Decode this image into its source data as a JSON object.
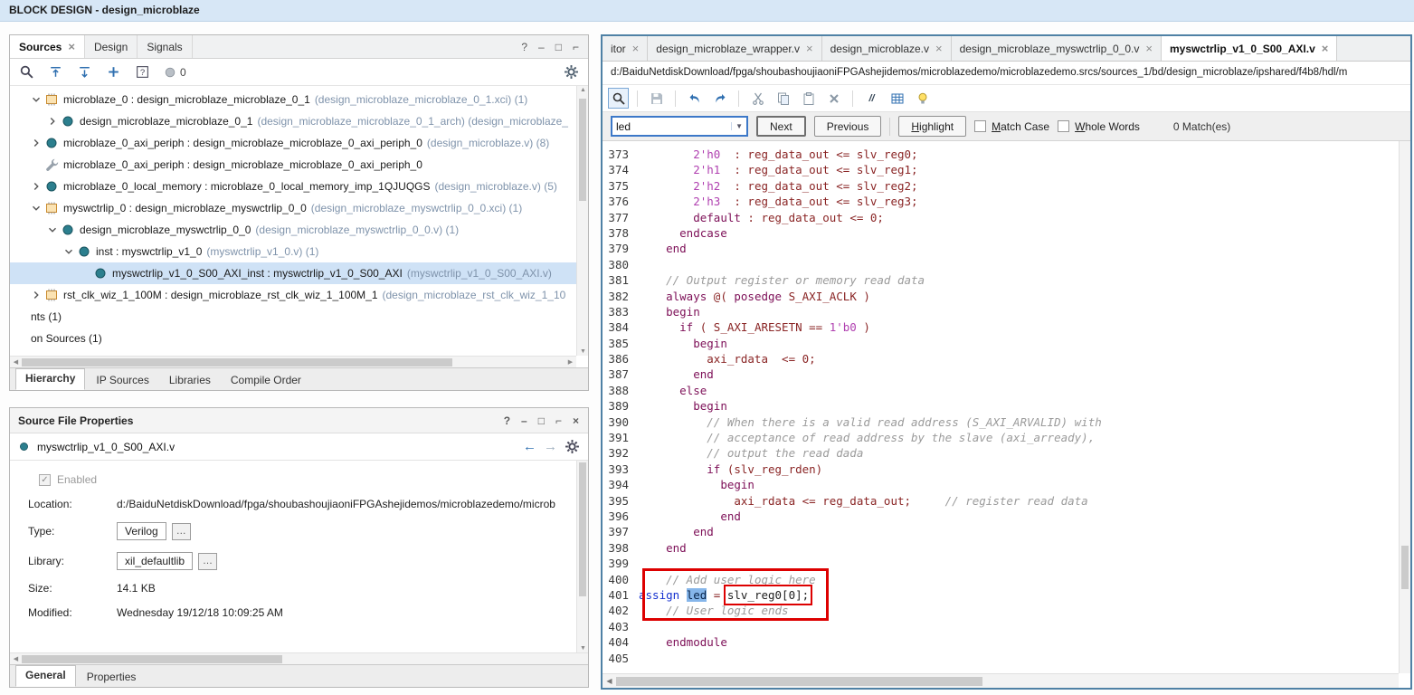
{
  "titlebar": {
    "title": "BLOCK DESIGN - design_microblaze"
  },
  "sources": {
    "tabs": [
      {
        "label": "Sources",
        "active": true,
        "closable": true
      },
      {
        "label": "Design",
        "active": false,
        "closable": false
      },
      {
        "label": "Signals",
        "active": false,
        "closable": false
      }
    ],
    "window_controls": [
      "help",
      "minimize",
      "maximize",
      "float"
    ],
    "toolbar": {
      "icons": [
        "search",
        "collapse-all",
        "expand-all",
        "add",
        "help-box"
      ],
      "messages_count": "0"
    },
    "tree": [
      {
        "indent": 1,
        "arrow": "open",
        "icon": "ip",
        "main": "microblaze_0 : design_microblaze_microblaze_0_1",
        "dim": "(design_microblaze_microblaze_0_1.xci) (1)",
        "selected": false
      },
      {
        "indent": 2,
        "arrow": "closed",
        "icon": "module",
        "main": "design_microblaze_microblaze_0_1",
        "dim": "(design_microblaze_microblaze_0_1_arch) (design_microblaze_",
        "selected": false
      },
      {
        "indent": 1,
        "arrow": "closed",
        "icon": "module",
        "main": "microblaze_0_axi_periph : design_microblaze_microblaze_0_axi_periph_0",
        "dim": "(design_microblaze.v) (8)",
        "selected": false
      },
      {
        "indent": 1,
        "arrow": "none",
        "icon": "wrench",
        "main": "microblaze_0_axi_periph : design_microblaze_microblaze_0_axi_periph_0",
        "dim": "",
        "selected": false
      },
      {
        "indent": 1,
        "arrow": "closed",
        "icon": "module",
        "main": "microblaze_0_local_memory : microblaze_0_local_memory_imp_1QJUQGS",
        "dim": "(design_microblaze.v) (5)",
        "selected": false
      },
      {
        "indent": 1,
        "arrow": "open",
        "icon": "ip",
        "main": "myswctrlip_0 : design_microblaze_myswctrlip_0_0",
        "dim": "(design_microblaze_myswctrlip_0_0.xci) (1)",
        "selected": false
      },
      {
        "indent": 2,
        "arrow": "open",
        "icon": "module",
        "main": "design_microblaze_myswctrlip_0_0",
        "dim": "(design_microblaze_myswctrlip_0_0.v) (1)",
        "selected": false
      },
      {
        "indent": 3,
        "arrow": "open",
        "icon": "module",
        "main": "inst : myswctrlip_v1_0",
        "dim": "(myswctrlip_v1_0.v) (1)",
        "selected": false
      },
      {
        "indent": 4,
        "arrow": "none",
        "icon": "module",
        "main": "myswctrlip_v1_0_S00_AXI_inst : myswctrlip_v1_0_S00_AXI",
        "dim": "(myswctrlip_v1_0_S00_AXI.v)",
        "selected": true
      },
      {
        "indent": 1,
        "arrow": "closed",
        "icon": "ip",
        "main": "rst_clk_wiz_1_100M : design_microblaze_rst_clk_wiz_1_100M_1",
        "dim": "(design_microblaze_rst_clk_wiz_1_10",
        "selected": false
      },
      {
        "indent": 0,
        "arrow": "none",
        "icon": "none",
        "main": "nts (1)",
        "dim": "",
        "selected": false
      },
      {
        "indent": 0,
        "arrow": "none",
        "icon": "none",
        "main": "on Sources (1)",
        "dim": "",
        "selected": false
      }
    ],
    "bottom_tabs": [
      {
        "label": "Hierarchy",
        "active": true
      },
      {
        "label": "IP Sources",
        "active": false
      },
      {
        "label": "Libraries",
        "active": false
      },
      {
        "label": "Compile Order",
        "active": false
      }
    ]
  },
  "properties": {
    "title": "Source File Properties",
    "window_controls": [
      "help",
      "minimize",
      "maximize",
      "float",
      "close"
    ],
    "file_name": "myswctrlip_v1_0_S00_AXI.v",
    "enabled_label": "Enabled",
    "fields": [
      {
        "label": "Location:",
        "value": "d:/BaiduNetdiskDownload/fpga/shoubashoujiaoniFPGAshejidemos/microblazedemo/microb",
        "boxed": false,
        "more": false
      },
      {
        "label": "Type:",
        "value": "Verilog",
        "boxed": true,
        "more": true
      },
      {
        "label": "Library:",
        "value": "xil_defaultlib",
        "boxed": true,
        "more": true
      },
      {
        "label": "Size:",
        "value": "14.1 KB",
        "boxed": false,
        "more": false
      },
      {
        "label": "Modified:",
        "value": "Wednesday 19/12/18 10:09:25 AM",
        "boxed": false,
        "more": false
      }
    ],
    "bottom_tabs": [
      {
        "label": "General",
        "active": true
      },
      {
        "label": "Properties",
        "active": false
      }
    ]
  },
  "editor": {
    "tabs": [
      {
        "label": "itor",
        "active": false
      },
      {
        "label": "design_microblaze_wrapper.v",
        "active": false
      },
      {
        "label": "design_microblaze.v",
        "active": false
      },
      {
        "label": "design_microblaze_myswctrlip_0_0.v",
        "active": false
      },
      {
        "label": "myswctrlip_v1_0_S00_AXI.v",
        "active": true
      }
    ],
    "path": "d:/BaiduNetdiskDownload/fpga/shoubashoujiaoniFPGAshejidemos/microblazedemo/microblazedemo.srcs/sources_1/bd/design_microblaze/ipshared/f4b8/hdl/m",
    "toolbar": [
      "search",
      "save",
      "undo",
      "redo",
      "cut",
      "copy",
      "paste",
      "delete",
      "comment",
      "grid",
      "bulb"
    ],
    "find": {
      "query": "led",
      "next_label": "Next",
      "previous_label": "Previous",
      "highlight_label": "Highlight",
      "match_case_label": "Match Case",
      "whole_words_label": "Whole Words",
      "matches_label": "0 Match(es)"
    },
    "code": {
      "first_line": 373,
      "lines": [
        [
          [
            "p",
            "        "
          ],
          [
            "l",
            "2'h0"
          ],
          [
            "p",
            "  : reg_data_out <= slv_reg0;"
          ]
        ],
        [
          [
            "p",
            "        "
          ],
          [
            "l",
            "2'h1"
          ],
          [
            "p",
            "  : reg_data_out <= slv_reg1;"
          ]
        ],
        [
          [
            "p",
            "        "
          ],
          [
            "l",
            "2'h2"
          ],
          [
            "p",
            "  : reg_data_out <= slv_reg2;"
          ]
        ],
        [
          [
            "p",
            "        "
          ],
          [
            "l",
            "2'h3"
          ],
          [
            "p",
            "  : reg_data_out <= slv_reg3;"
          ]
        ],
        [
          [
            "p",
            "        "
          ],
          [
            "k",
            "default"
          ],
          [
            "p",
            " : reg_data_out <= 0;"
          ]
        ],
        [
          [
            "p",
            "      "
          ],
          [
            "k",
            "endcase"
          ]
        ],
        [
          [
            "p",
            "    "
          ],
          [
            "k",
            "end"
          ]
        ],
        [],
        [
          [
            "p",
            "    "
          ],
          [
            "c",
            "// Output register or memory read data"
          ]
        ],
        [
          [
            "p",
            "    "
          ],
          [
            "k",
            "always"
          ],
          [
            "p",
            " @( "
          ],
          [
            "k",
            "posedge"
          ],
          [
            "p",
            " S_AXI_ACLK )"
          ]
        ],
        [
          [
            "p",
            "    "
          ],
          [
            "k",
            "begin"
          ]
        ],
        [
          [
            "p",
            "      "
          ],
          [
            "k",
            "if"
          ],
          [
            "p",
            " ( S_AXI_ARESETN == "
          ],
          [
            "l",
            "1'b0"
          ],
          [
            "p",
            " )"
          ]
        ],
        [
          [
            "p",
            "        "
          ],
          [
            "k",
            "begin"
          ]
        ],
        [
          [
            "p",
            "          axi_rdata  <= 0;"
          ]
        ],
        [
          [
            "p",
            "        "
          ],
          [
            "k",
            "end"
          ]
        ],
        [
          [
            "p",
            "      "
          ],
          [
            "k",
            "else"
          ]
        ],
        [
          [
            "p",
            "        "
          ],
          [
            "k",
            "begin"
          ]
        ],
        [
          [
            "p",
            "          "
          ],
          [
            "c",
            "// When there is a valid read address (S_AXI_ARVALID) with"
          ]
        ],
        [
          [
            "p",
            "          "
          ],
          [
            "c",
            "// acceptance of read address by the slave (axi_arready),"
          ]
        ],
        [
          [
            "p",
            "          "
          ],
          [
            "c",
            "// output the read dada"
          ]
        ],
        [
          [
            "p",
            "          "
          ],
          [
            "k",
            "if"
          ],
          [
            "p",
            " (slv_reg_rden)"
          ]
        ],
        [
          [
            "p",
            "            "
          ],
          [
            "k",
            "begin"
          ]
        ],
        [
          [
            "p",
            "              axi_rdata <= reg_data_out;     "
          ],
          [
            "c",
            "// register read data"
          ]
        ],
        [
          [
            "p",
            "            "
          ],
          [
            "k",
            "end"
          ]
        ],
        [
          [
            "p",
            "        "
          ],
          [
            "k",
            "end"
          ]
        ],
        [
          [
            "p",
            "    "
          ],
          [
            "k",
            "end"
          ]
        ],
        [],
        [
          [
            "p",
            "    "
          ],
          [
            "c",
            "// Add user logic here"
          ]
        ],
        [
          [
            "a",
            "assign"
          ],
          [
            "p",
            " "
          ],
          [
            "s",
            "led"
          ],
          [
            "p",
            " = "
          ],
          [
            "u",
            "slv_reg0[0];"
          ]
        ],
        [
          [
            "p",
            "    "
          ],
          [
            "c",
            "// User logic ends"
          ]
        ],
        [],
        [
          [
            "p",
            "    "
          ],
          [
            "k",
            "endmodule"
          ]
        ],
        []
      ]
    }
  },
  "colors": {
    "accent_blue": "#2f6fb0",
    "titlebar_blue": "#d7e7f6",
    "tree_selection": "#cfe2f6",
    "annotation_red": "#dd0000",
    "editor_focus_border": "#4f81a5"
  }
}
